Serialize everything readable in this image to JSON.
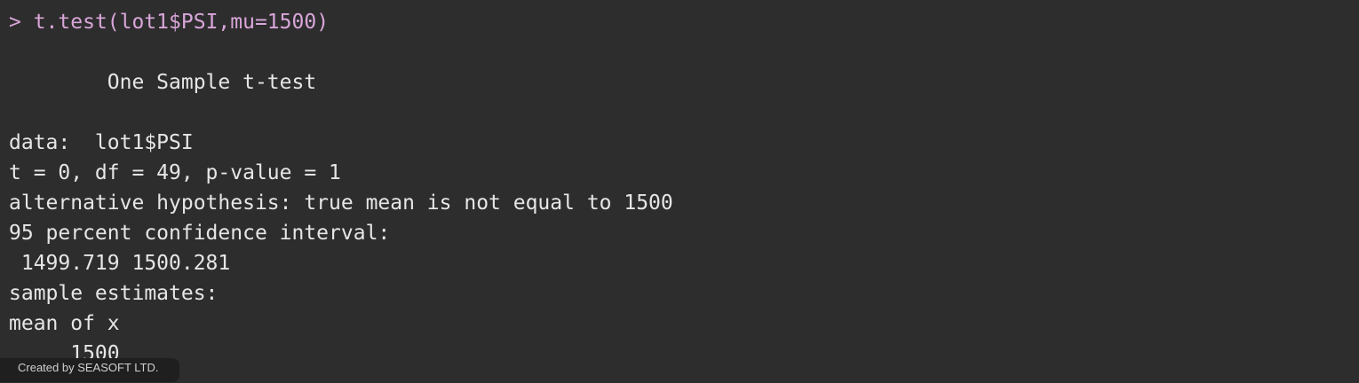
{
  "console": {
    "prompt": "> ",
    "command": "t.test(lot1$PSI,mu=1500)",
    "output": {
      "title": "        One Sample t-test",
      "data_line": "data:  lot1$PSI",
      "stats_line": "t = 0, df = 49, p-value = 1",
      "alt_line": "alternative hypothesis: true mean is not equal to 1500",
      "ci_header": "95 percent confidence interval:",
      "ci_values": " 1499.719 1500.281",
      "estimates_header": "sample estimates:",
      "mean_label": "mean of x",
      "mean_value": "     1500"
    }
  },
  "watermark": {
    "text": "Created by SEASOFT LTD."
  },
  "colors": {
    "background": "#2d2d2d",
    "text": "#e6e6e6",
    "command": "#d9a6d9"
  }
}
